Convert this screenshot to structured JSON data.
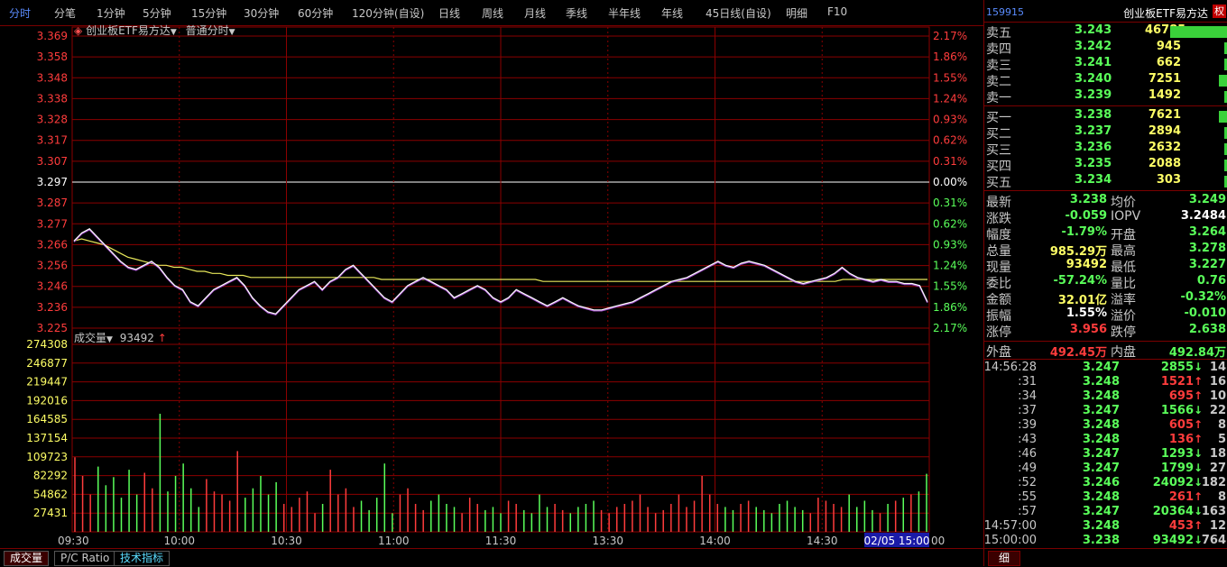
{
  "tabs": [
    "分时",
    "分笔",
    "1分钟",
    "5分钟",
    "15分钟",
    "30分钟",
    "60分钟",
    "120分钟(自设)",
    "日线",
    "周线",
    "月线",
    "季线",
    "半年线",
    "年线",
    "45日线(自设)",
    "明细",
    "F10"
  ],
  "active_tab": "分时",
  "chart_header": {
    "name": "创业板ETF易方达",
    "mode": "普通分时"
  },
  "price_ticks": [
    "3.369",
    "3.358",
    "3.348",
    "3.338",
    "3.328",
    "3.317",
    "3.307",
    "3.297",
    "3.287",
    "3.277",
    "3.266",
    "3.256",
    "3.246",
    "3.236",
    "3.225"
  ],
  "pct_ticks": [
    "2.17%",
    "1.86%",
    "1.55%",
    "1.24%",
    "0.93%",
    "0.62%",
    "0.31%",
    "0.00%",
    "0.31%",
    "0.62%",
    "0.93%",
    "1.24%",
    "1.55%",
    "1.86%",
    "2.17%"
  ],
  "volume_header": {
    "label": "成交量",
    "value": "93492",
    "arrow": "↑"
  },
  "volume_ticks": [
    "274308",
    "246877",
    "219447",
    "192016",
    "164585",
    "137154",
    "109723",
    "82292",
    "54862",
    "27431"
  ],
  "time_ticks": [
    "09:30",
    "10:00",
    "10:30",
    "11:00",
    "11:30",
    "13:30",
    "14:00",
    "14:30"
  ],
  "time_highlight": "02/05 15:00",
  "time_end": "00",
  "colors": {
    "up": "#ff3c3c",
    "down": "#5aff5a",
    "grid": "#8b0000",
    "price_line": "#ffffff",
    "avg_line": "#e8e85a",
    "label_yellow": "#ffff66"
  },
  "chart_data": {
    "type": "line",
    "price_ylim": [
      3.225,
      3.369
    ],
    "prev_close": 3.297,
    "volume_ylim": [
      0,
      301739
    ],
    "x_sessions": [
      "09:30",
      "10:00",
      "10:30",
      "11:00",
      "11:30/13:00",
      "13:30",
      "14:00",
      "14:30",
      "15:00"
    ],
    "price_series": [
      3.268,
      3.272,
      3.274,
      3.27,
      3.266,
      3.262,
      3.258,
      3.255,
      3.254,
      3.256,
      3.258,
      3.255,
      3.25,
      3.246,
      3.244,
      3.238,
      3.236,
      3.24,
      3.244,
      3.246,
      3.248,
      3.25,
      3.246,
      3.24,
      3.236,
      3.233,
      3.232,
      3.236,
      3.24,
      3.244,
      3.246,
      3.248,
      3.244,
      3.248,
      3.25,
      3.254,
      3.256,
      3.252,
      3.248,
      3.244,
      3.24,
      3.238,
      3.242,
      3.246,
      3.248,
      3.25,
      3.248,
      3.246,
      3.244,
      3.24,
      3.242,
      3.244,
      3.246,
      3.244,
      3.24,
      3.238,
      3.24,
      3.244,
      3.242,
      3.24,
      3.238,
      3.236,
      3.238,
      3.24,
      3.238,
      3.236,
      3.235,
      3.234,
      3.234,
      3.235,
      3.236,
      3.237,
      3.238,
      3.24,
      3.242,
      3.244,
      3.246,
      3.248,
      3.249,
      3.25,
      3.252,
      3.254,
      3.256,
      3.258,
      3.256,
      3.255,
      3.257,
      3.258,
      3.257,
      3.256,
      3.254,
      3.252,
      3.25,
      3.248,
      3.247,
      3.248,
      3.249,
      3.25,
      3.252,
      3.255,
      3.252,
      3.25,
      3.249,
      3.248,
      3.249,
      3.248,
      3.248,
      3.247,
      3.247,
      3.246,
      3.238
    ],
    "avg_series": [
      3.268,
      3.269,
      3.268,
      3.267,
      3.266,
      3.264,
      3.262,
      3.26,
      3.259,
      3.258,
      3.257,
      3.256,
      3.256,
      3.255,
      3.255,
      3.254,
      3.253,
      3.253,
      3.252,
      3.252,
      3.251,
      3.251,
      3.251,
      3.25,
      3.25,
      3.25,
      3.25,
      3.25,
      3.25,
      3.25,
      3.25,
      3.25,
      3.25,
      3.25,
      3.25,
      3.25,
      3.25,
      3.25,
      3.25,
      3.25,
      3.249,
      3.249,
      3.249,
      3.249,
      3.249,
      3.249,
      3.249,
      3.249,
      3.249,
      3.249,
      3.249,
      3.249,
      3.249,
      3.249,
      3.249,
      3.249,
      3.249,
      3.249,
      3.249,
      3.249,
      3.249,
      3.248,
      3.248,
      3.248,
      3.248,
      3.248,
      3.248,
      3.248,
      3.248,
      3.248,
      3.248,
      3.248,
      3.248,
      3.248,
      3.248,
      3.248,
      3.248,
      3.248,
      3.248,
      3.248,
      3.248,
      3.248,
      3.248,
      3.248,
      3.248,
      3.248,
      3.248,
      3.248,
      3.248,
      3.248,
      3.248,
      3.248,
      3.248,
      3.248,
      3.248,
      3.248,
      3.248,
      3.248,
      3.248,
      3.248,
      3.249,
      3.249,
      3.249,
      3.249,
      3.249,
      3.249,
      3.249,
      3.249,
      3.249,
      3.249,
      3.249,
      3.249
    ],
    "volume_series": [
      120000,
      90000,
      60000,
      105000,
      75000,
      88000,
      55000,
      100000,
      60000,
      95000,
      70000,
      190000,
      65000,
      90000,
      110000,
      70000,
      40000,
      85000,
      65000,
      60000,
      50000,
      130000,
      55000,
      70000,
      90000,
      60000,
      80000,
      45000,
      40000,
      55000,
      65000,
      30000,
      45000,
      100000,
      60000,
      70000,
      40000,
      50000,
      35000,
      55000,
      110000,
      30000,
      60000,
      70000,
      45000,
      35000,
      50000,
      60000,
      45000,
      40000,
      30000,
      55000,
      45000,
      35000,
      40000,
      30000,
      50000,
      45000,
      35000,
      30000,
      60000,
      40000,
      45000,
      35000,
      30000,
      40000,
      45000,
      50000,
      35000,
      30000,
      40000,
      45000,
      50000,
      60000,
      40000,
      30000,
      35000,
      45000,
      60000,
      40000,
      50000,
      90000,
      60000,
      45000,
      40000,
      35000,
      45000,
      50000,
      40000,
      35000,
      30000,
      45000,
      50000,
      40000,
      35000,
      30000,
      55000,
      50000,
      45000,
      40000,
      60000,
      40000,
      50000,
      35000,
      30000,
      45000,
      50000,
      55000,
      60000,
      65000,
      93492
    ]
  },
  "right_panel": {
    "code": "159915",
    "name": "创业板ETF易方达",
    "badge": "权",
    "asks": [
      {
        "label": "卖五",
        "price": "3.243",
        "vol": "46785"
      },
      {
        "label": "卖四",
        "price": "3.242",
        "vol": "945"
      },
      {
        "label": "卖三",
        "price": "3.241",
        "vol": "662"
      },
      {
        "label": "卖二",
        "price": "3.240",
        "vol": "7251"
      },
      {
        "label": "卖一",
        "price": "3.239",
        "vol": "1492"
      }
    ],
    "bids": [
      {
        "label": "买一",
        "price": "3.238",
        "vol": "7621"
      },
      {
        "label": "买二",
        "price": "3.237",
        "vol": "2894"
      },
      {
        "label": "买三",
        "price": "3.236",
        "vol": "2632"
      },
      {
        "label": "买四",
        "price": "3.235",
        "vol": "2088"
      },
      {
        "label": "买五",
        "price": "3.234",
        "vol": "303"
      }
    ],
    "stats_left": [
      {
        "label": "最新",
        "value": "3.238"
      },
      {
        "label": "涨跌",
        "value": "-0.059"
      },
      {
        "label": "幅度",
        "value": "-1.79%"
      },
      {
        "label": "总量",
        "value": "985.29万"
      },
      {
        "label": "现量",
        "value": "93492"
      },
      {
        "label": "委比",
        "value": "-57.24%"
      },
      {
        "label": "金额",
        "value": "32.01亿"
      },
      {
        "label": "振幅",
        "value": "1.55%"
      },
      {
        "label": "涨停",
        "value": "3.956"
      }
    ],
    "stats_right": [
      {
        "label": "均价",
        "value": "3.249"
      },
      {
        "label": "IOPV",
        "value": "3.2484"
      },
      {
        "label": "开盘",
        "value": "3.264"
      },
      {
        "label": "最高",
        "value": "3.278"
      },
      {
        "label": "最低",
        "value": "3.227"
      },
      {
        "label": "量比",
        "value": "0.76"
      },
      {
        "label": "溢率",
        "value": "-0.32%"
      },
      {
        "label": "溢价",
        "value": "-0.010"
      },
      {
        "label": "跌停",
        "value": "2.638"
      }
    ],
    "outer_label": "外盘",
    "outer_value": "492.45万",
    "inner_label": "内盘",
    "inner_value": "492.84万",
    "ticks": [
      {
        "time": "14:56:28",
        "price": "3.247",
        "vol": "2855",
        "dir": "down",
        "n": "14"
      },
      {
        "time": ":31",
        "price": "3.248",
        "vol": "1521",
        "dir": "up",
        "n": "16"
      },
      {
        "time": ":34",
        "price": "3.248",
        "vol": "695",
        "dir": "up",
        "n": "10"
      },
      {
        "time": ":37",
        "price": "3.247",
        "vol": "1566",
        "dir": "down",
        "n": "22"
      },
      {
        "time": ":39",
        "price": "3.248",
        "vol": "605",
        "dir": "up",
        "n": "8"
      },
      {
        "time": ":43",
        "price": "3.248",
        "vol": "136",
        "dir": "up",
        "n": "5"
      },
      {
        "time": ":46",
        "price": "3.247",
        "vol": "1293",
        "dir": "down",
        "n": "18"
      },
      {
        "time": ":49",
        "price": "3.247",
        "vol": "1799",
        "dir": "down",
        "n": "27"
      },
      {
        "time": ":52",
        "price": "3.246",
        "vol": "24092",
        "dir": "down",
        "n": "182"
      },
      {
        "time": ":55",
        "price": "3.248",
        "vol": "261",
        "dir": "up",
        "n": "8"
      },
      {
        "time": ":57",
        "price": "3.247",
        "vol": "20364",
        "dir": "down",
        "n": "163"
      },
      {
        "time": "14:57:00",
        "price": "3.248",
        "vol": "453",
        "dir": "up",
        "n": "12"
      },
      {
        "time": "15:00:00",
        "price": "3.238",
        "vol": "93492",
        "dir": "down",
        "n": "764"
      }
    ],
    "bottom_tab": "细"
  },
  "bottom_tabs": [
    "成交量",
    "P/C Ratio",
    "技术指标"
  ]
}
